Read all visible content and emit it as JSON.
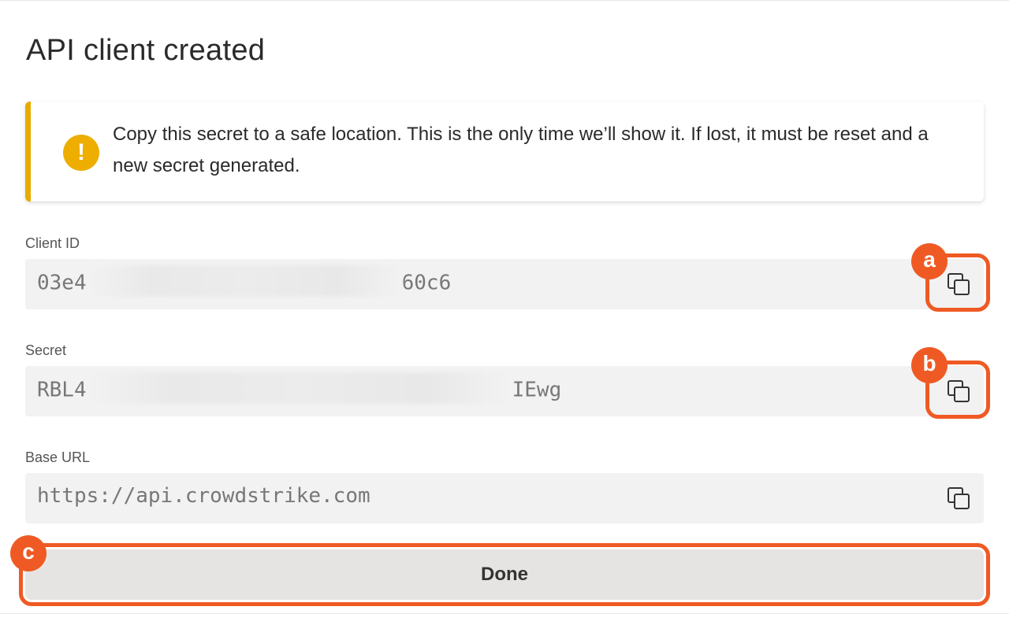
{
  "dialog": {
    "title": "API client created"
  },
  "alert": {
    "icon": "warning-icon",
    "color": "#e9aa00",
    "message": "Copy this secret to a safe location. This is the only time we’ll show it. If lost, it must be reset and a new secret generated."
  },
  "fields": {
    "client_id": {
      "label": "Client ID",
      "value_prefix": "03e4",
      "value_suffix": "60c6",
      "copy_icon": "copy-icon"
    },
    "secret": {
      "label": "Secret",
      "value_prefix": "RBL4",
      "value_suffix": "IEwg",
      "copy_icon": "copy-icon"
    },
    "base_url": {
      "label": "Base URL",
      "value": "https://api.crowdstrike.com",
      "copy_icon": "copy-icon"
    }
  },
  "annotations": {
    "color": "#ef5a24",
    "a": "a",
    "b": "b",
    "c": "c"
  },
  "actions": {
    "done_label": "Done"
  }
}
